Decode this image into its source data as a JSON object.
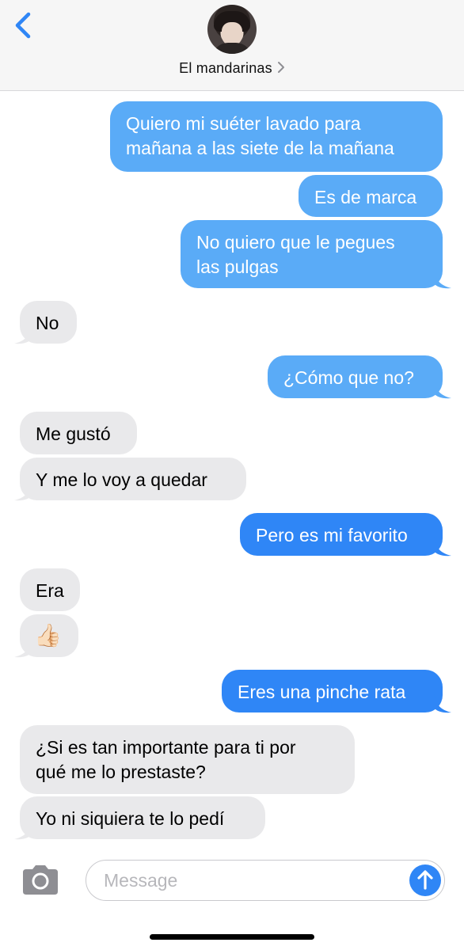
{
  "header": {
    "contact_name": "El mandarinas",
    "chevron": ">"
  },
  "messages": [
    {
      "from": "me",
      "text": "Quiero mi suéter lavado para\nmañana a las siete de la mañana"
    },
    {
      "from": "me",
      "text": "Es de marca"
    },
    {
      "from": "me",
      "text": "No quiero que le pegues\nlas pulgas"
    },
    {
      "from": "them",
      "text": "No"
    },
    {
      "from": "me",
      "text": "¿Cómo que no?"
    },
    {
      "from": "them",
      "text": "Me gustó"
    },
    {
      "from": "them",
      "text": "Y me lo voy a quedar"
    },
    {
      "from": "me",
      "text": "Pero es mi favorito"
    },
    {
      "from": "them",
      "text": "Era"
    },
    {
      "from": "them",
      "text": "👍🏻"
    },
    {
      "from": "me",
      "text": "Eres una pinche rata"
    },
    {
      "from": "them",
      "text": "¿Si es tan importante para ti por\nqué me lo prestaste?"
    },
    {
      "from": "them",
      "text": "Yo ni siquiera te lo pedí"
    }
  ],
  "composer": {
    "placeholder": "Message"
  },
  "icons": {
    "back": "chevron-left-icon",
    "camera": "camera-icon",
    "send": "arrow-up-icon"
  },
  "colors": {
    "sent_bubble": "#2f86f6",
    "received_bubble": "#e9e9eb",
    "accent": "#2f86f6"
  }
}
